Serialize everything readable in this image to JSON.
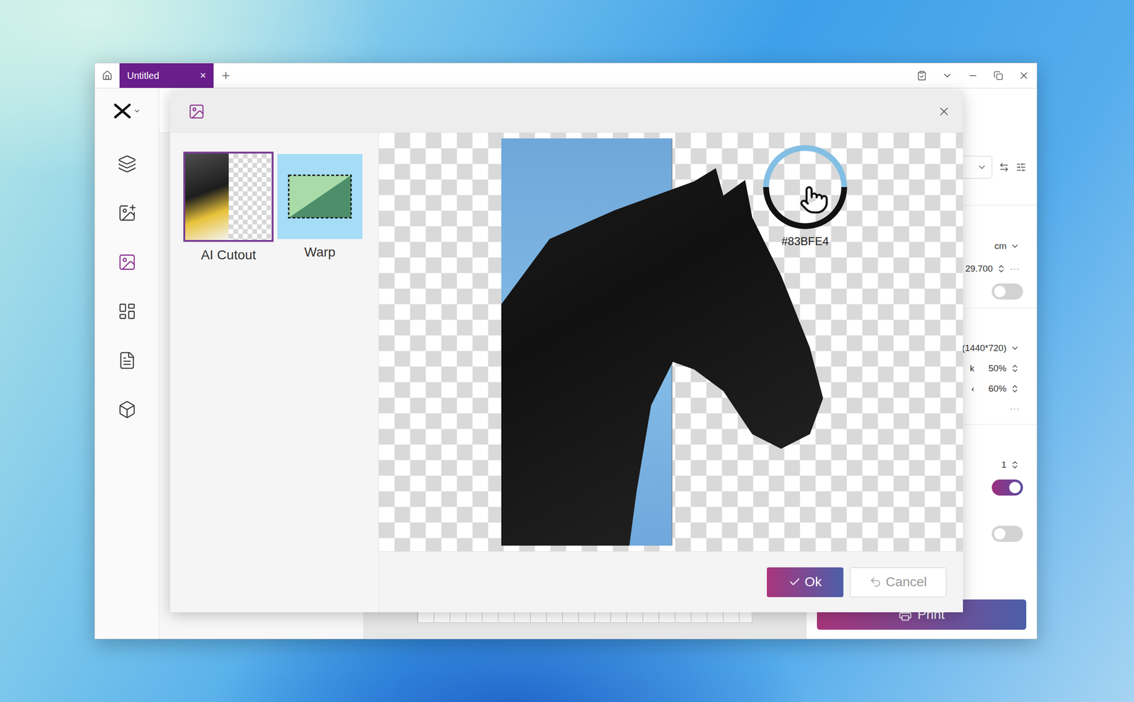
{
  "window": {
    "tabs": [
      {
        "label": "Untitled",
        "selected": true,
        "close": "×"
      }
    ],
    "new_tab": "+"
  },
  "sidebar": {
    "items": [
      {
        "selected": false
      },
      {
        "selected": false
      },
      {
        "selected": true
      },
      {
        "selected": false
      },
      {
        "selected": false
      },
      {
        "selected": false
      }
    ]
  },
  "dialog": {
    "tools": [
      {
        "label": "AI Cutout",
        "selected": true
      },
      {
        "label": "Warp",
        "selected": false
      }
    ],
    "color_picker": {
      "value": "#83BFE4",
      "color": "#83BFE4"
    },
    "buttons": [
      {
        "label": "Ok",
        "kind": "primary"
      },
      {
        "label": "Cancel",
        "kind": "secondary"
      }
    ]
  },
  "right_panel": {
    "unit": "cm",
    "size": "29.700",
    "size_more": "···",
    "option_on": false,
    "resolution": "(1440*720)",
    "sliders": [
      {
        "label": "k",
        "value": "50%"
      },
      {
        "label": "‹",
        "value": "60%"
      }
    ],
    "more": "···",
    "copies": "1",
    "switches": [
      {
        "on": true
      },
      {
        "on": false
      }
    ],
    "print": "Print"
  }
}
